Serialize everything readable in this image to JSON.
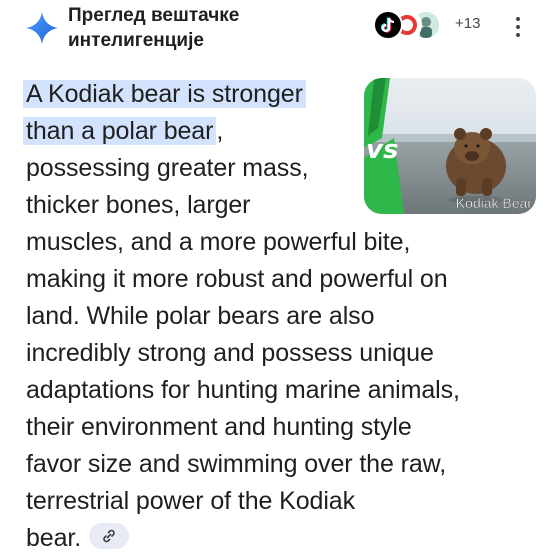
{
  "header": {
    "title_line1": "Преглед вештачке",
    "title_line2": "интелигенције",
    "sources_more": "+13",
    "icons": [
      "spark-icon",
      "tiktok-icon",
      "source-avatar-icon",
      "source-avatar-icon",
      "more-vert-icon"
    ]
  },
  "thumbnail": {
    "caption": "Kodiak Bear",
    "vs_text": "vs"
  },
  "answer": {
    "lines": [
      "A Kodiak bear is stronger",
      "than a polar bear",
      ",",
      "possessing greater mass,",
      "thicker bones, larger",
      "muscles, and a more powerful bite,",
      "making it more robust and powerful on",
      "land. While polar bears are also",
      "incredibly strong and possess unique",
      "adaptations for hunting marine animals,",
      "their environment and hunting style",
      "favor size and swimming over the raw,",
      "terrestrial power of the Kodiak",
      "bear."
    ],
    "link_icon": "link-icon"
  },
  "colors": {
    "highlight": "#d3e3fd",
    "text": "#1f1f1f",
    "spark_gradient_start": "#4285f4",
    "spark_gradient_end": "#1a73e8",
    "thumbnail_accent": "#34a853"
  }
}
